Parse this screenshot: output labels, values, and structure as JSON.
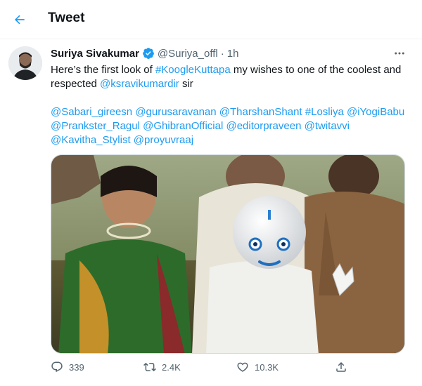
{
  "header": {
    "title": "Tweet"
  },
  "tweet": {
    "author_name": "Suriya Sivakumar",
    "handle": "@Suriya_offl",
    "separator": "·",
    "time": "1h",
    "line1_prefix": "Here’s the first look of ",
    "line1_hashtag": "#KoogleKuttapa",
    "line1_suffix": " my wishes to one of the coolest and",
    "line2_prefix": "respected ",
    "line2_mention": "@ksravikumardir",
    "line2_suffix": " sir",
    "tags": [
      "@Sabari_gireesn",
      "@gurusaravanan",
      "@TharshanShant",
      "#Losliya",
      "@iYogiBabu",
      "@Prankster_Ragul",
      "@GhibranOfficial",
      "@editorpraveen",
      "@twitavvi",
      "@Kavitha_Stylist",
      "@proyuvraaj"
    ]
  },
  "actions": {
    "replies": "339",
    "retweets": "2.4K",
    "likes": "10.3K"
  },
  "colors": {
    "accent": "#1d9bf0",
    "secondary_text": "#536471",
    "primary_text": "#0f1419"
  },
  "icons": {
    "back": "arrow-left-icon",
    "verified": "verified-badge-icon",
    "more": "more-horizontal-icon",
    "reply": "reply-icon",
    "retweet": "retweet-icon",
    "like": "heart-icon",
    "share": "share-icon"
  }
}
